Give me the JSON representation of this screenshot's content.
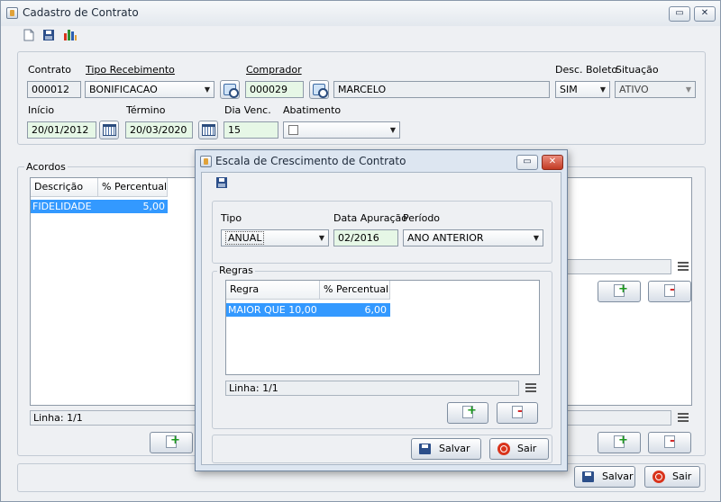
{
  "main": {
    "title": "Cadastro de Contrato",
    "win_restore": "▭",
    "win_close": "✕",
    "labels": {
      "contrato": "Contrato",
      "tipo_recebimento": "Tipo Recebimento",
      "comprador": "Comprador",
      "desc_boleto": "Desc. Boleto",
      "situacao": "Situação",
      "inicio": "Início",
      "termino": "Término",
      "dia_venc": "Dia Venc.",
      "abatimento": "Abatimento"
    },
    "values": {
      "contrato": "000012",
      "tipo_recebimento": "BONIFICACAO",
      "comprador_code": "000029",
      "comprador_name": "MARCELO",
      "desc_boleto": "SIM",
      "situacao": "ATIVO",
      "inicio": "20/01/2012",
      "termino": "20/03/2020",
      "dia_venc": "15",
      "abatimento": ""
    },
    "acordos": {
      "title": "Acordos",
      "columns": [
        "Descrição",
        "% Percentual"
      ],
      "rows": [
        {
          "descricao": "FIDELIDADE",
          "percentual": "5,00"
        }
      ],
      "status": "Linha: 1/1"
    },
    "buttons": {
      "save": "Salvar",
      "exit": "Sair"
    }
  },
  "dialog": {
    "title": "Escala de Crescimento de Contrato",
    "win_restore": "▭",
    "win_close": "✕",
    "labels": {
      "tipo": "Tipo",
      "data_apuracao": "Data Apuração",
      "periodo": "Período"
    },
    "values": {
      "tipo": "ANUAL",
      "data_apuracao": "02/2016",
      "periodo": "ANO ANTERIOR"
    },
    "regras": {
      "title": "Regras",
      "columns": [
        "Regra",
        "% Percentual"
      ],
      "rows": [
        {
          "regra": "MAIOR QUE 10,00",
          "percentual": "6,00"
        }
      ],
      "status": "Linha: 1/1"
    },
    "buttons": {
      "save": "Salvar",
      "exit": "Sair"
    }
  },
  "colors": {
    "selection": "#3399ff",
    "field_green": "#e6f7e6",
    "close_red": "#c23b23"
  }
}
